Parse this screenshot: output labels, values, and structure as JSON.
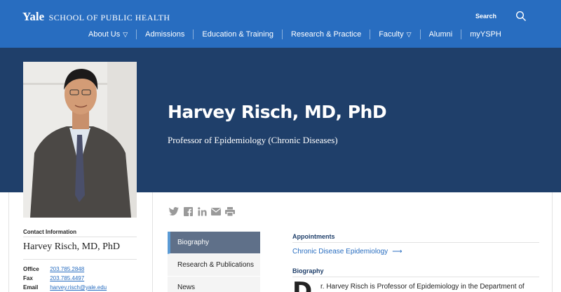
{
  "header": {
    "logo_yale": "Yale",
    "logo_school": "SCHOOL OF PUBLIC HEALTH",
    "search_label": "Search",
    "nav": [
      {
        "label": "About Us",
        "has_dropdown": true
      },
      {
        "label": "Admissions",
        "has_dropdown": false
      },
      {
        "label": "Education & Training",
        "has_dropdown": false
      },
      {
        "label": "Research & Practice",
        "has_dropdown": false
      },
      {
        "label": "Faculty",
        "has_dropdown": true
      },
      {
        "label": "Alumni",
        "has_dropdown": false
      },
      {
        "label": "myYSPH",
        "has_dropdown": false
      }
    ],
    "dropdown_glyph": "▽"
  },
  "hero": {
    "name": "Harvey Risch, MD, PhD",
    "title": "Professor of Epidemiology (Chronic Diseases)"
  },
  "contact": {
    "heading": "Contact Information",
    "name": "Harvey Risch, MD, PhD",
    "rows": [
      {
        "label": "Office",
        "value": "203.785.2848"
      },
      {
        "label": "Fax",
        "value": "203.785.4497"
      },
      {
        "label": "Email",
        "value": "harvey.risch@yale.edu"
      }
    ]
  },
  "share_icons": [
    "twitter-icon",
    "facebook-icon",
    "linkedin-icon",
    "email-icon",
    "print-icon"
  ],
  "side_menu": [
    {
      "label": "Biography",
      "active": true
    },
    {
      "label": "Research & Publications",
      "active": false
    },
    {
      "label": "News",
      "active": false
    }
  ],
  "main": {
    "appointments_heading": "Appointments",
    "appointment_link": "Chronic Disease Epidemiology",
    "appointment_arrow": "⟶",
    "biography_heading": "Biography",
    "bio_dropcap": "D",
    "bio_text": "r. Harvey Risch is Professor of Epidemiology in the Department of"
  },
  "colors": {
    "nav_blue": "#286dc0",
    "hero_navy": "#1f3f6a",
    "active_menu": "#5f7089",
    "link": "#286dc0"
  }
}
